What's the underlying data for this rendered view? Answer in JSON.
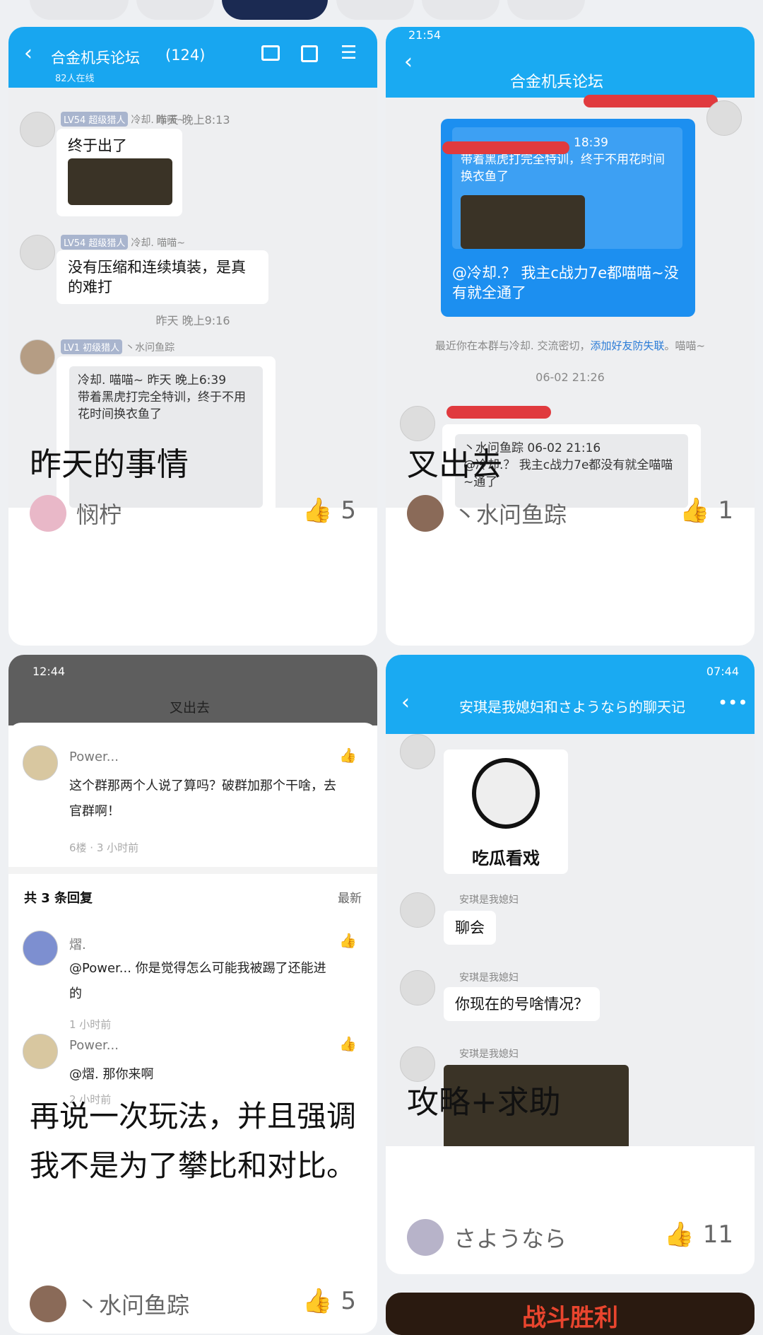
{
  "tabs": [
    "",
    "",
    "",
    "",
    "",
    ""
  ],
  "cards": [
    {
      "caption": "昨天的事情",
      "author": "悯柠",
      "likes": "5",
      "shot": {
        "header_title": "合金机兵论坛",
        "header_count": "(124)",
        "online": "82人在线",
        "time1": "昨天 晚上8:13",
        "user_lv": "LV54 超级猎人",
        "user_name": "冷却. 喵喵~",
        "msg1": "终于出了",
        "msg2": "没有压缩和连续填装，是真的难打",
        "time2": "昨天 晚上9:16",
        "user2_lv": "LV1 初级猎人",
        "user2_name": "丶水问鱼踪",
        "quote_head": "冷却. 喵喵~ 昨天 晚上6:39",
        "quote_body": "带着黑虎打完全特训，终于不用花时间换衣鱼了"
      }
    },
    {
      "caption": "叉出去",
      "author": "丶水问鱼踪",
      "likes": "1",
      "shot": {
        "status_time": "21:54",
        "header_title": "合金机兵论坛",
        "quote_time": "18:39",
        "quote_body": "带着黑虎打完全特训，终于不用花时间换衣鱼了",
        "reply": "@冷却.？ 我主c战力7e都喵喵~没有就全通了",
        "notice_a": "最近你在本群与冷却. 交流密切，",
        "notice_link": "添加好友防失联",
        "notice_b": "。喵喵~",
        "time": "06-02 21:26",
        "quote2_head": "丶水问鱼踪 06-02 21:16",
        "quote2_body": "@冷却.？ 我主c战力7e都没有就全喵喵~通了"
      }
    },
    {
      "caption": "再说一次玩法，并且强调我不是为了攀比和对比。",
      "author": "丶水问鱼踪",
      "likes": "5",
      "shot": {
        "status_time": "12:44",
        "header_title": "叉出去",
        "op_name": "Power...",
        "op_text": "这个群那两个人说了算吗？破群加那个干啥，去官群啊！",
        "op_meta": "6楼 · 3 小时前",
        "reply_count": "共 3 条回复",
        "sort": "最新",
        "r1_name": "熠.",
        "r1_text": "@Power... 你是觉得怎么可能我被踢了还能进的",
        "r1_meta": "1 小时前",
        "r2_name": "Power...",
        "r2_text": "@熠. 那你来啊",
        "r2_meta": "2 小时前"
      }
    },
    {
      "caption": "攻略+求助",
      "author": "さようなら",
      "likes": "11",
      "shot": {
        "status_time": "07:44",
        "header_title": "安琪是我媳妇和さようなら的聊天记",
        "sender": "安琪是我媳妇",
        "sticker_text": "吃瓜看戏",
        "msg1": "聊会",
        "msg2": "你现在的号啥情况？"
      }
    }
  ],
  "banner_text": "战斗胜利"
}
